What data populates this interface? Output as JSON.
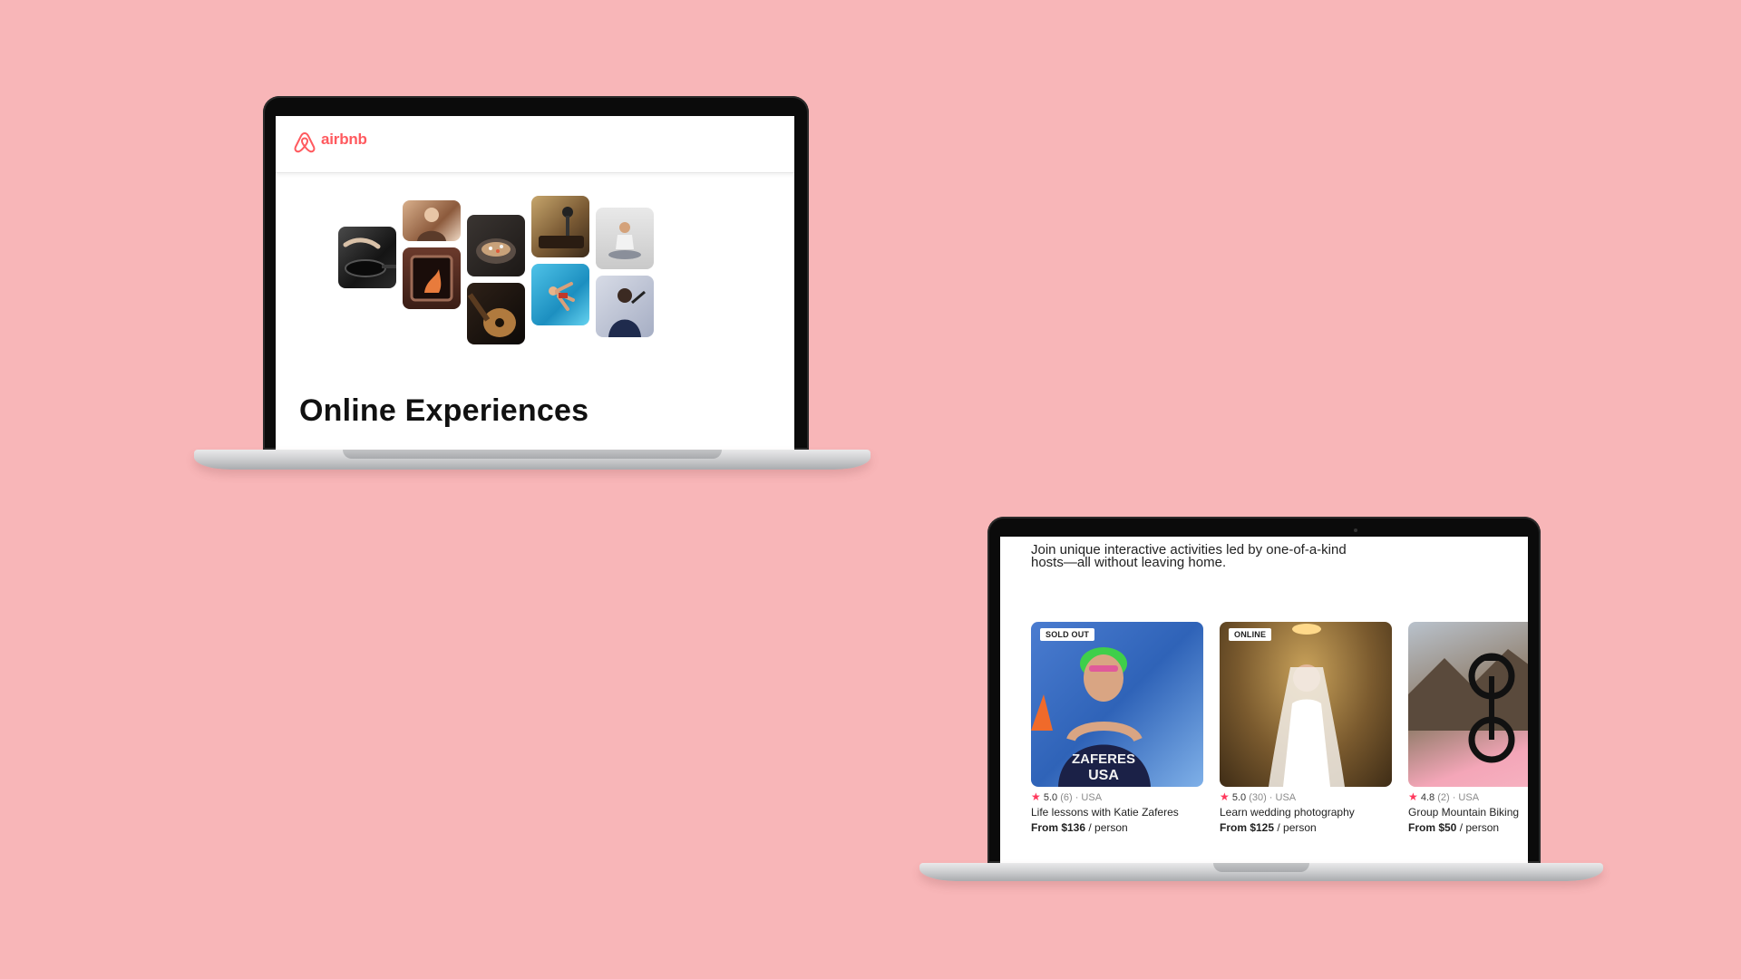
{
  "colors": {
    "background": "#f8b6b8",
    "brand": "#ff5a5f",
    "star": "#ff385c"
  },
  "top_laptop": {
    "brand": {
      "icon": "airbnb-logo-icon",
      "name": "airbnb"
    },
    "hero_title": "Online Experiences",
    "photos": [
      {
        "icon": "pan-cooking-icon"
      },
      {
        "icon": "person-portrait-icon"
      },
      {
        "icon": "fireplace-icon"
      },
      {
        "icon": "food-bowl-icon"
      },
      {
        "icon": "guitar-icon"
      },
      {
        "icon": "microphone-icon"
      },
      {
        "icon": "swimmer-icon"
      },
      {
        "icon": "yoga-icon"
      },
      {
        "icon": "performer-icon"
      }
    ]
  },
  "bottom_laptop": {
    "intro": "Join unique interactive activities led by one-of-a-kind hosts—all without leaving home.",
    "cards": [
      {
        "badge": "SOLD OUT",
        "rating": "5.0",
        "reviews": "(6)",
        "location": "USA",
        "title": "Life lessons with Katie Zaferes",
        "price": "From $136",
        "per": "/ person",
        "jersey": "ZAFERES",
        "jersey_country": "USA"
      },
      {
        "badge": "ONLINE",
        "rating": "5.0",
        "reviews": "(30)",
        "location": "USA",
        "title": "Learn wedding photography",
        "price": "From $125",
        "per": "/ person"
      },
      {
        "rating": "4.8",
        "reviews": "(2)",
        "location": "USA",
        "title": "Group Mountain Biking",
        "price": "From $50",
        "per": "/ person"
      }
    ]
  }
}
